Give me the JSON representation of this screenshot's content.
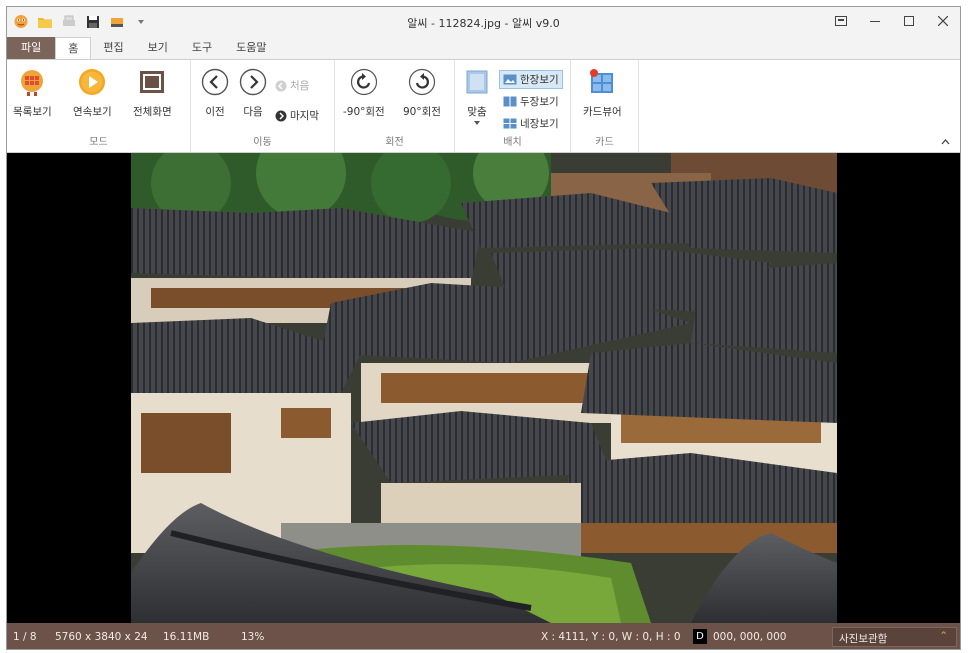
{
  "window": {
    "title": "알씨 - 112824.jpg - 알씨 v9.0",
    "controls": [
      "restore-icon",
      "minimize-icon",
      "maximize-icon",
      "close-icon"
    ]
  },
  "qat": {
    "icons": [
      "alsee-logo-icon",
      "open-folder-icon",
      "print-icon",
      "save-icon",
      "scan-icon",
      "dropdown-icon"
    ]
  },
  "tabs": [
    {
      "label": "파일"
    },
    {
      "label": "홈"
    },
    {
      "label": "편집"
    },
    {
      "label": "보기"
    },
    {
      "label": "도구"
    },
    {
      "label": "도움말"
    }
  ],
  "ribbon": {
    "mode": {
      "label": "모드",
      "list_view": "목록보기",
      "slideshow": "연속보기",
      "fullscreen": "전체화면"
    },
    "move": {
      "label": "이동",
      "prev": "이전",
      "next": "다음",
      "first": "처음",
      "last": "마지막"
    },
    "rotate": {
      "label": "회전",
      "ccw": "-90°회전",
      "cw": "90°회전"
    },
    "layout": {
      "label": "배치",
      "fit": "맞춤",
      "single": "한장보기",
      "double": "두장보기",
      "quad": "네장보기"
    },
    "card": {
      "label": "카드",
      "viewer": "카드뷰어"
    }
  },
  "status": {
    "index": "1 / 8",
    "dimensions": "5760 x 3840 x 24",
    "filesize": "16.11MB",
    "zoom": "13%",
    "coords": "X : 4111, Y : 0, W : 0, H : 0",
    "d_label": "D",
    "color_value": "000, 000, 000",
    "album": "사진보관함"
  },
  "colors": {
    "status_bg": "#6c5248",
    "file_tab": "#7b6459",
    "accent_orange": "#f0a33a"
  }
}
